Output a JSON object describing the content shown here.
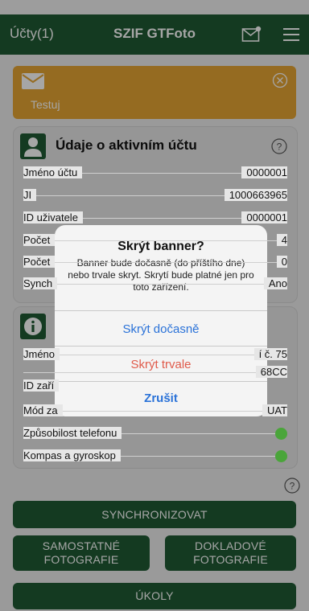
{
  "header": {
    "accounts_label": "Účty(1)",
    "app_title": "SZIF GTFoto",
    "mail_icon": "mail-notification-icon",
    "menu_icon": "hamburger-menu-icon"
  },
  "banner": {
    "text": "Testuj",
    "icon": "envelope-icon",
    "close_icon": "circle-close-icon",
    "color": "#e5a533"
  },
  "account_card": {
    "title": "Údaje o aktivním účtu",
    "rows": [
      {
        "label": "Jméno účtu",
        "value": "0000001"
      },
      {
        "label": "JI",
        "value": "1000663965"
      },
      {
        "label": "ID uživatele",
        "value": "0000001"
      },
      {
        "label": "Počet",
        "value": "4"
      },
      {
        "label": "Počet",
        "value": "0"
      },
      {
        "label": "Synch",
        "value": "Ano"
      }
    ]
  },
  "device_card": {
    "rows": [
      {
        "label": "Jméno",
        "value": "í č. 75"
      },
      {
        "label": "ID zaří",
        "value": "68CC"
      },
      {
        "label": "Mód za",
        "value": "UAT"
      },
      {
        "label": "Způsobilost telefonu",
        "status": "ok"
      },
      {
        "label": "Kompas a gyroskop",
        "status": "ok"
      }
    ]
  },
  "buttons": {
    "sync": "SYNCHRONIZOVAT",
    "standalone_line1": "SAMOSTATNÉ",
    "standalone_line2": "FOTOGRAFIE",
    "document_line1": "DOKLADOVÉ",
    "document_line2": "FOTOGRAFIE",
    "tasks": "ÚKOLY"
  },
  "dialog": {
    "title": "Skrýt banner?",
    "message": "Banner bude dočasně (do příštího dne) nebo trvale skryt. Skrytí bude platné jen pro toto zařízení.",
    "hide_temporarily": "Skrýt dočasně",
    "hide_permanently": "Skrýt trvale",
    "cancel": "Zrušit"
  },
  "colors": {
    "brand_green": "#1f5a34",
    "status_green": "#4aa53a",
    "link_blue": "#2a72d8",
    "destructive_red": "#e05a4a"
  }
}
